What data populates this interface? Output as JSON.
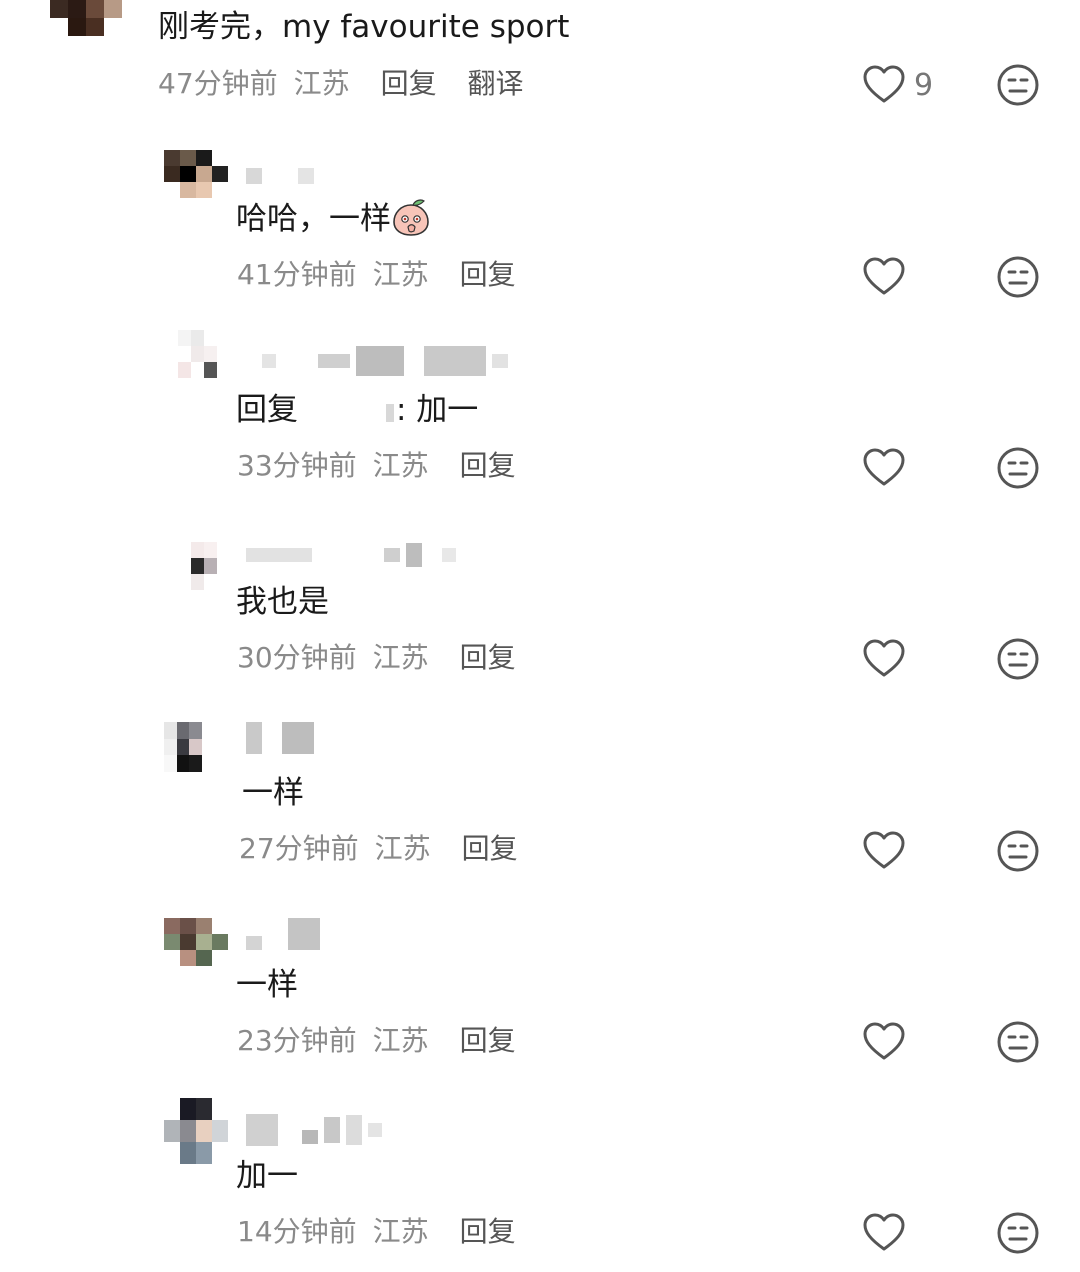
{
  "comments": [
    {
      "text": "刚考完，my favourite sport",
      "time": "47分钟前",
      "location": "江苏",
      "reply_label": "回复",
      "translate_label": "翻译",
      "like_count": "9"
    },
    {
      "text": "哈哈，一样",
      "time": "41分钟前",
      "location": "江苏",
      "reply_label": "回复"
    },
    {
      "reply_prefix": "回复",
      "text": ": 加一",
      "time": "33分钟前",
      "location": "江苏",
      "reply_label": "回复"
    },
    {
      "text": "我也是",
      "time": "30分钟前",
      "location": "江苏",
      "reply_label": "回复"
    },
    {
      "text": "一样",
      "time": "27分钟前",
      "location": "江苏",
      "reply_label": "回复"
    },
    {
      "text": "一样",
      "time": "23分钟前",
      "location": "江苏",
      "reply_label": "回复"
    },
    {
      "text": "加一",
      "time": "14分钟前",
      "location": "江苏",
      "reply_label": "回复"
    }
  ],
  "icons": {
    "like": "heart-outline-icon",
    "dislike": "meh-face-icon",
    "emoji": "peach-emoji-icon"
  },
  "colors": {
    "text": "#1a1a1a",
    "meta": "#8a8a8a",
    "icon": "#555555"
  }
}
